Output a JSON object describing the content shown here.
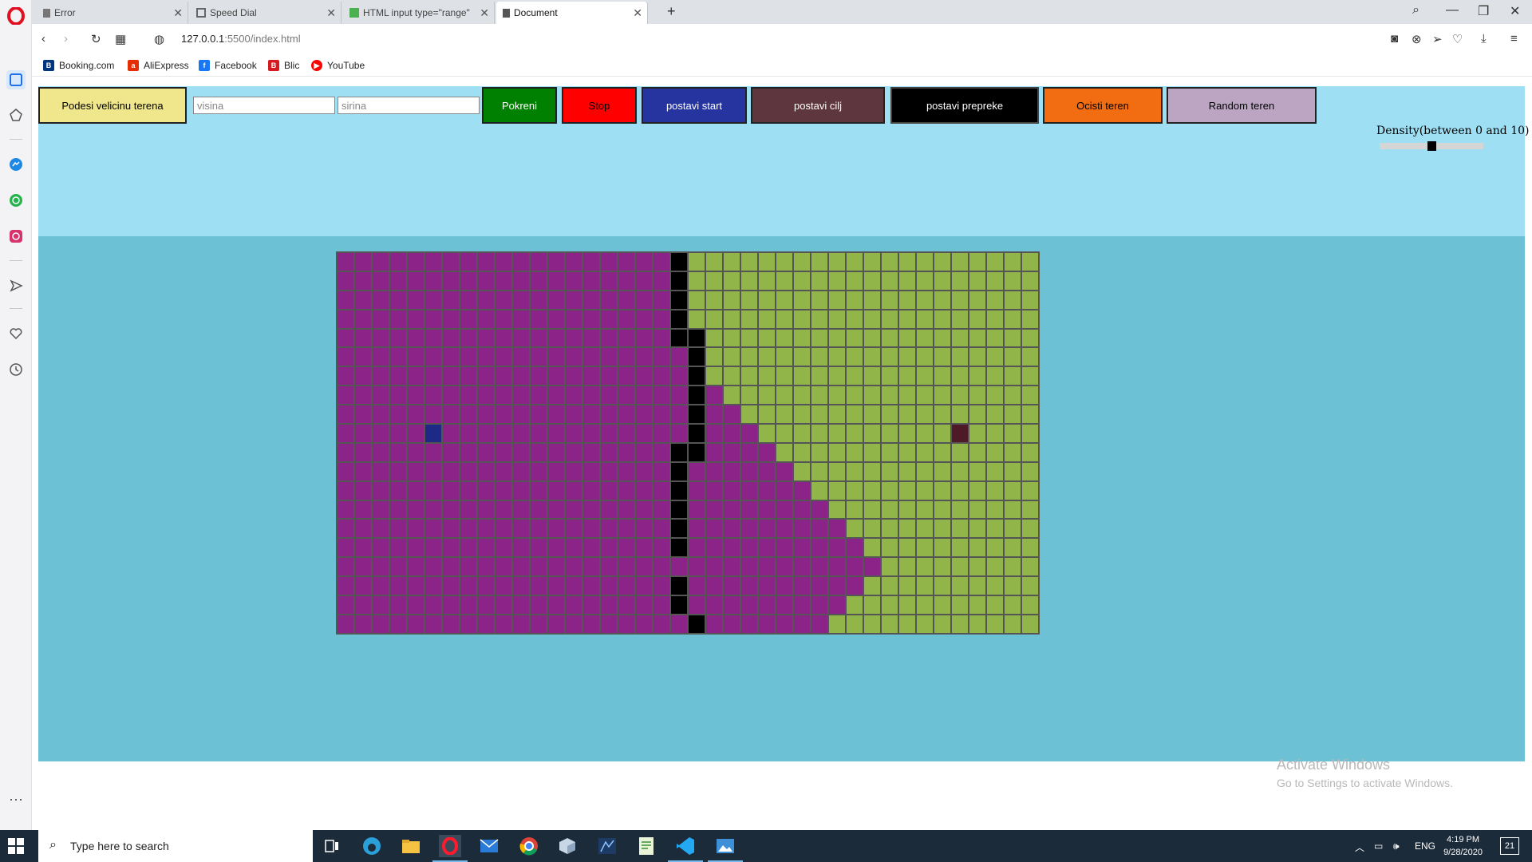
{
  "browser": {
    "tabs": [
      {
        "title": "Error",
        "active": false
      },
      {
        "title": "Speed Dial",
        "active": false
      },
      {
        "title": "HTML input type=\"range\"",
        "active": false
      },
      {
        "title": "Document",
        "active": true
      }
    ],
    "url_host": "127.0.0.1",
    "url_rest": ":5500/index.html",
    "bookmarks": [
      "Booking.com",
      "AliExpress",
      "Facebook",
      "Blic",
      "YouTube"
    ]
  },
  "toolbar": {
    "set_size_label": "Podesi velicinu terena",
    "height_placeholder": "visina",
    "width_placeholder": "sirina",
    "run_label": "Pokreni",
    "stop_label": "Stop",
    "set_start_label": "postavi start",
    "set_goal_label": "postavi cilj",
    "set_obstacles_label": "postavi prepreke",
    "clear_label": "Ocisti teren",
    "random_label": "Random teren",
    "density_label": "Density(between 0 and 10)",
    "density_value": 5,
    "density_min": 0,
    "density_max": 10
  },
  "colors": {
    "set_size": "#f0e68c",
    "run": "#008000",
    "stop": "#ff0000",
    "set_start": "#2634a0",
    "set_goal": "#5e363d",
    "set_obstacles": "#000000",
    "clear": "#f26c12",
    "random": "#bba5c3",
    "visited": "#8b2389",
    "unvisited": "#92b54a",
    "wall": "#000000",
    "start": "#1d2985",
    "goal": "#4e1a28",
    "toolbar_bg": "#9edff4",
    "page_bg": "#6cc1d4"
  },
  "grid": {
    "rows": 20,
    "cols": 40,
    "start": {
      "row": 9,
      "col": 5
    },
    "goal": {
      "row": 9,
      "col": 35
    },
    "walls": [
      [
        0,
        19
      ],
      [
        1,
        19
      ],
      [
        2,
        19
      ],
      [
        3,
        19
      ],
      [
        4,
        19
      ],
      [
        4,
        20
      ],
      [
        5,
        20
      ],
      [
        6,
        20
      ],
      [
        7,
        20
      ],
      [
        8,
        20
      ],
      [
        9,
        20
      ],
      [
        10,
        19
      ],
      [
        10,
        20
      ],
      [
        11,
        19
      ],
      [
        12,
        19
      ],
      [
        13,
        19
      ],
      [
        14,
        19
      ],
      [
        15,
        19
      ],
      [
        17,
        19
      ],
      [
        18,
        19
      ],
      [
        19,
        20
      ]
    ],
    "frontier_visited_cols": [
      19,
      19,
      19,
      19,
      19,
      20,
      21,
      22,
      23,
      24,
      25,
      26,
      27,
      28,
      29,
      30,
      31,
      30,
      29,
      28
    ]
  },
  "watermark": {
    "line1": "Activate Windows",
    "line2": "Go to Settings to activate Windows."
  },
  "taskbar": {
    "search_placeholder": "Type here to search",
    "language": "ENG",
    "time": "4:19 PM",
    "date": "9/28/2020",
    "notifications": "21"
  }
}
